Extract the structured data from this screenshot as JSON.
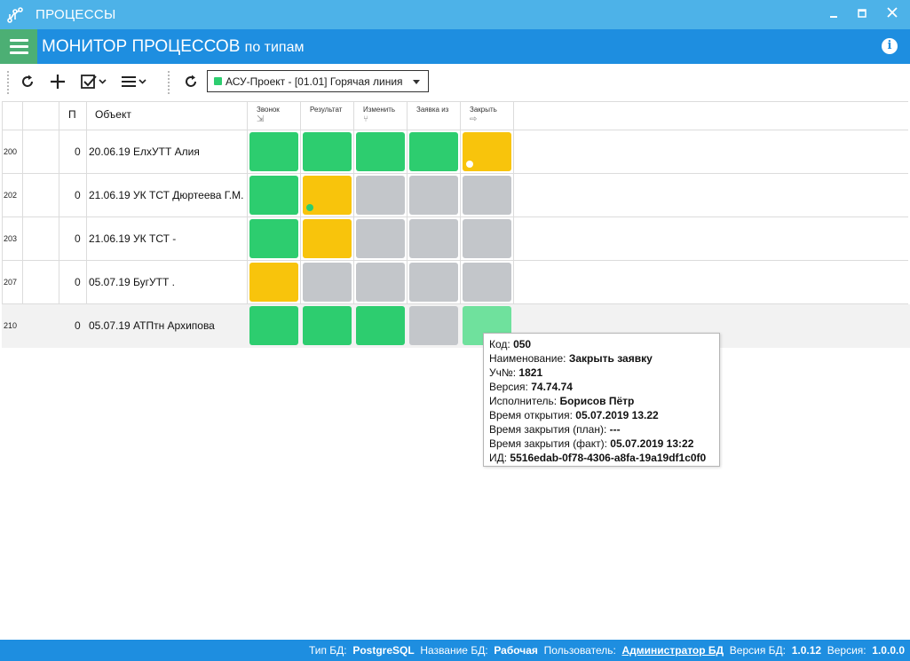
{
  "window": {
    "title": "ПРОЦЕССЫ"
  },
  "header": {
    "title_main": "МОНИТОР ПРОЦЕССОВ",
    "title_suffix": "по типам"
  },
  "toolbar": {
    "selector_value": "АСУ-Проект - [01.01] Горячая линия",
    "selector_color": "#2dcd6f"
  },
  "table": {
    "columns": {
      "p": "П",
      "object": "Объект"
    },
    "steps": [
      {
        "label": "Звонок",
        "icon": "login-icon"
      },
      {
        "label": "Результат",
        "icon": ""
      },
      {
        "label": "Изменить",
        "icon": "merge-icon"
      },
      {
        "label": "Заявка из",
        "icon": ""
      },
      {
        "label": "Закрыть",
        "icon": "logout-icon"
      }
    ],
    "rows": [
      {
        "id": "200",
        "p": "0",
        "object": "20.06.19  ЕлхУТТ  Алия",
        "cells": [
          "g",
          "g",
          "g",
          "g",
          "y"
        ],
        "marks": [
          null,
          null,
          null,
          null,
          "white"
        ]
      },
      {
        "id": "202",
        "p": "0",
        "object": "21.06.19  УК ТСТ  Дюртеева Г.М.",
        "cells": [
          "g",
          "y",
          "s",
          "s",
          "s"
        ],
        "marks": [
          null,
          "green",
          null,
          null,
          null
        ]
      },
      {
        "id": "203",
        "p": "0",
        "object": "21.06.19  УК ТСТ  -",
        "cells": [
          "g",
          "y",
          "s",
          "s",
          "s"
        ],
        "marks": [
          null,
          null,
          null,
          null,
          null
        ]
      },
      {
        "id": "207",
        "p": "0",
        "object": "05.07.19  БугУТТ  .",
        "cells": [
          "y",
          "s",
          "s",
          "s",
          "s"
        ],
        "marks": [
          null,
          null,
          null,
          null,
          null
        ]
      },
      {
        "id": "210",
        "p": "0",
        "object": "05.07.19  АТПтн  Архипова",
        "cells": [
          "g",
          "g",
          "g",
          "s",
          "lg"
        ],
        "marks": [
          null,
          null,
          null,
          null,
          null
        ]
      }
    ]
  },
  "tooltip": {
    "lines": [
      {
        "k": "Код: ",
        "v": "050"
      },
      {
        "k": "Наименование: ",
        "v": "Закрыть заявку"
      },
      {
        "k": "Уч№: ",
        "v": "1821"
      },
      {
        "k": "Версия: ",
        "v": "74.74.74"
      },
      {
        "k": "Исполнитель: ",
        "v": "Борисов Пётр"
      },
      {
        "k": "Время открытия: ",
        "v": "05.07.2019 13.22"
      },
      {
        "k": "Время закрытия (план): ",
        "v": "---"
      },
      {
        "k": "Время закрытия (факт): ",
        "v": "05.07.2019 13:22"
      },
      {
        "k": "ИД: ",
        "v": "5516edab-0f78-4306-a8fa-19a19df1c0f0"
      }
    ]
  },
  "status": {
    "db_type_label": "Тип БД:",
    "db_type": "PostgreSQL",
    "db_name_label": "Название БД:",
    "db_name": "Рабочая",
    "user_label": "Пользователь:",
    "user": "Администратор БД",
    "db_version_label": "Версия БД:",
    "db_version": "1.0.12",
    "version_label": "Версия:",
    "version": "1.0.0.0"
  },
  "colors": {
    "green": "#2dcd6f",
    "yellow": "#f8c40c",
    "gray": "#c3c6ca",
    "light_green": "#6fe19d",
    "header": "#1e8ee0",
    "titlebar": "#4db2e8"
  }
}
